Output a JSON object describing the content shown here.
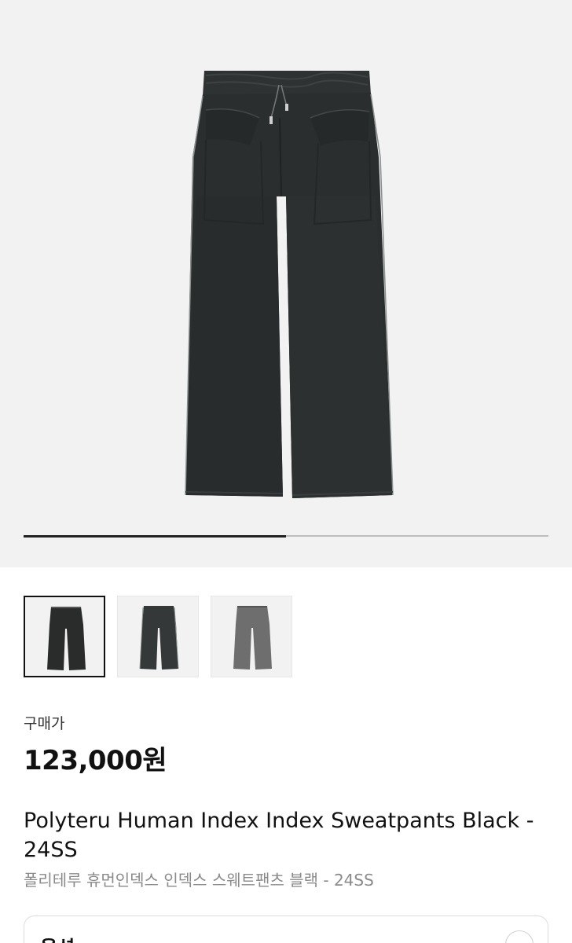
{
  "gallery": {
    "current_index": 1,
    "total_images": 2,
    "thumbnails": [
      {
        "name": "black-pants-thumb",
        "color": "#2a2c2c",
        "selected": true
      },
      {
        "name": "charcoal-pants-thumb",
        "color": "#353838",
        "selected": false
      },
      {
        "name": "gray-pants-thumb",
        "color": "#6e6e6e",
        "selected": false
      }
    ]
  },
  "colors": {
    "hero_background": "#f2f2f2",
    "pants_main": "#2b2e2e",
    "piping": "#8a8f8f"
  },
  "product": {
    "price_label": "구매가",
    "price": "123,000원",
    "title_en": "Polyteru Human Index Index Sweatpants Black - 24SS",
    "title_ko": "폴리테루 휴먼인덱스 인덱스 스웨트팬츠 블랙 - 24SS"
  },
  "option": {
    "label": "옵션",
    "toggle_icon": "minus-icon"
  }
}
